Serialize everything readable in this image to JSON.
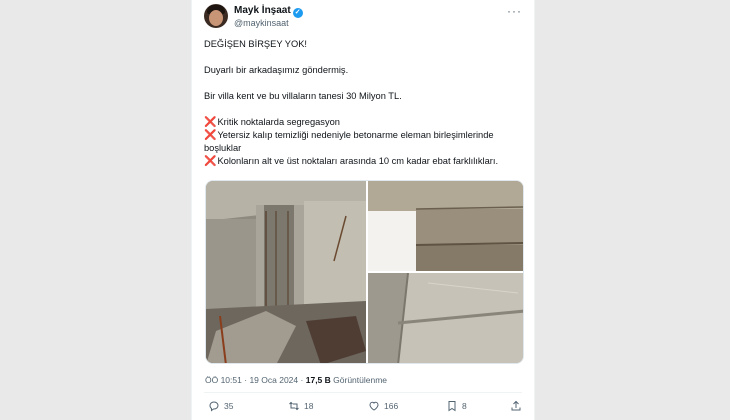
{
  "author": {
    "name": "Mayk İnşaat",
    "handle": "@maykinsaat",
    "verified_badge": "✓",
    "more_icon": "more-horizontal-icon"
  },
  "tweet": {
    "line1": "DEĞİŞEN BİRŞEY YOK!",
    "line2": "Duyarlı bir arkadaşımız göndermiş.",
    "line3": "Bir villa kent ve bu villaların tanesi 30 Milyon TL.",
    "bullet_marker": "❌",
    "bullets": [
      "Kritik noktalarda segregasyon",
      "Yetersiz kalıp temizliği nedeniyle betonarme eleman birleşimlerinde boşluklar",
      "Kolonların alt ve üst noktaları arasında 10 cm kadar ebat farklılıkları."
    ]
  },
  "meta": {
    "time": "ÖÖ 10:51",
    "separator": "·",
    "date": "19 Oca 2024",
    "views_count": "17,5 B",
    "views_label": "Görüntülenme"
  },
  "actions": {
    "replies": "35",
    "retweets": "18",
    "likes": "166",
    "bookmarks": "8"
  },
  "colors": {
    "verified": "#1d9bf0",
    "cross": "#e0245e",
    "muted": "#536471"
  }
}
